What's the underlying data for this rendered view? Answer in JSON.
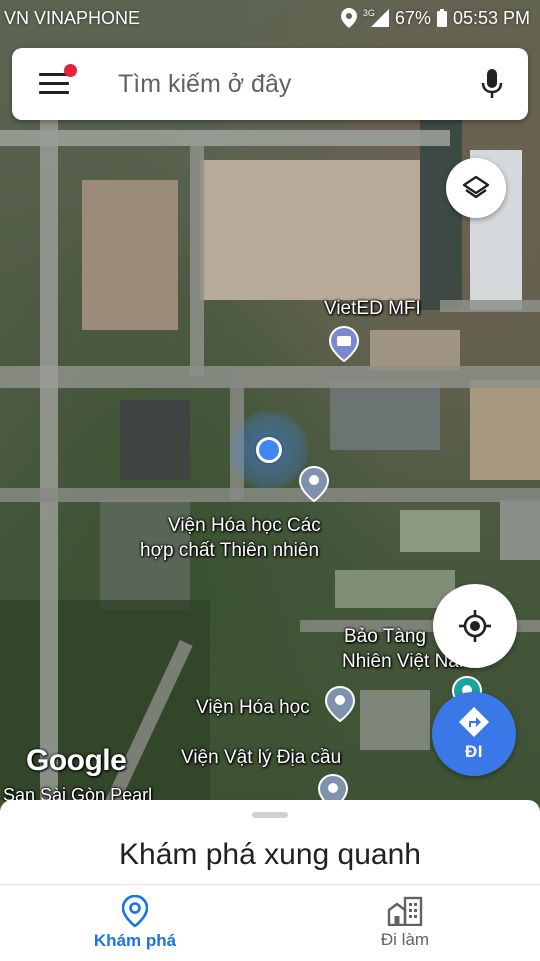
{
  "status_bar": {
    "carrier": "VN VINAPHONE",
    "network": "3G",
    "battery": "67%",
    "time": "05:53 PM"
  },
  "search": {
    "placeholder": "Tìm kiếm ở đây"
  },
  "map": {
    "labels": {
      "vieted": "VietED MFI",
      "vien_hoa_hoc_cac_line1": "Viện Hóa học Các",
      "vien_hoa_hoc_cac_line2": "hợp chất Thiên nhiên",
      "bao_tang_line1": "Bảo Tàng",
      "bao_tang_line2": "Nhiên Việt Nam",
      "vien_hoa_hoc": "Viện Hóa học",
      "vien_vat_ly": "Viện Vật lý Địa cầu",
      "san_sai_gon": "San Sài Gòn Pearl"
    },
    "logo": "Google"
  },
  "controls": {
    "go_label": "ĐI"
  },
  "sheet": {
    "title": "Khám phá xung quanh"
  },
  "bottom_nav": {
    "items": [
      {
        "label": "Khám phá",
        "active": true
      },
      {
        "label": "Đi làm",
        "active": false
      }
    ]
  },
  "colors": {
    "accent": "#1a73e8",
    "go_button": "#3b78e7",
    "notification_dot": "#e8213a",
    "location_dot": "#4285f4"
  }
}
